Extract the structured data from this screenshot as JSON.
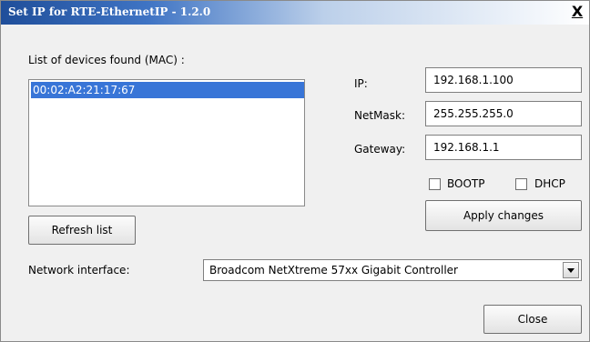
{
  "window": {
    "title": "Set IP for RTE-EthernetIP - 1.2.0",
    "close_glyph": "X"
  },
  "devices": {
    "label": "List of devices found (MAC) :",
    "items": [
      "00:02:A2:21:17:67"
    ],
    "refresh_label": "Refresh list"
  },
  "settings": {
    "ip_label": "IP:",
    "ip_value": "192.168.1.100",
    "netmask_label": "NetMask:",
    "netmask_value": "255.255.255.0",
    "gateway_label": "Gateway:",
    "gateway_value": "192.168.1.1",
    "bootp_label": "BOOTP",
    "dhcp_label": "DHCP",
    "apply_label": "Apply changes"
  },
  "network": {
    "label": "Network interface:",
    "selected": "Broadcom NetXtreme 57xx Gigabit Controller"
  },
  "footer": {
    "close_label": "Close"
  },
  "colors": {
    "title_start": "#1f4e9a",
    "selection": "#3875d7",
    "window_bg": "#f0f0f0"
  }
}
